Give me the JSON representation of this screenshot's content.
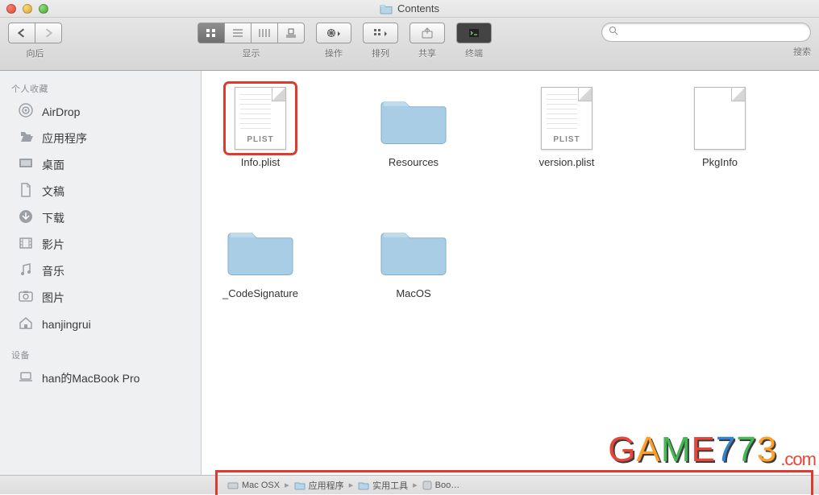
{
  "window": {
    "title": "Contents"
  },
  "toolbar": {
    "back_forward_label": "向后",
    "view_label": "显示",
    "action_label": "操作",
    "arrange_label": "排列",
    "share_label": "共享",
    "terminal_label": "终端",
    "search_label": "搜索",
    "search_placeholder": ""
  },
  "sidebar": {
    "favorites_header": "个人收藏",
    "devices_header": "设备",
    "favorites": [
      {
        "label": "AirDrop",
        "icon": "airdrop-icon"
      },
      {
        "label": "应用程序",
        "icon": "apps-icon"
      },
      {
        "label": "桌面",
        "icon": "desktop-icon"
      },
      {
        "label": "文稿",
        "icon": "documents-icon"
      },
      {
        "label": "下载",
        "icon": "downloads-icon"
      },
      {
        "label": "影片",
        "icon": "movies-icon"
      },
      {
        "label": "音乐",
        "icon": "music-icon"
      },
      {
        "label": "图片",
        "icon": "pictures-icon"
      },
      {
        "label": "hanjingrui",
        "icon": "home-icon"
      }
    ],
    "devices": [
      {
        "label": "han的MacBook Pro",
        "icon": "laptop-icon"
      }
    ]
  },
  "files": [
    {
      "name": "Info.plist",
      "kind": "plist",
      "selected": true
    },
    {
      "name": "Resources",
      "kind": "folder",
      "selected": false
    },
    {
      "name": "version.plist",
      "kind": "plist",
      "selected": false
    },
    {
      "name": "PkgInfo",
      "kind": "file",
      "selected": false
    },
    {
      "name": "_CodeSignature",
      "kind": "folder",
      "selected": false
    },
    {
      "name": "MacOS",
      "kind": "folder",
      "selected": false
    }
  ],
  "pathbar": {
    "segments": [
      {
        "label": "Mac OSX",
        "icon": "disk-icon"
      },
      {
        "label": "应用程序",
        "icon": "folder-icon"
      },
      {
        "label": "实用工具",
        "icon": "folder-icon"
      },
      {
        "label": "Boo…",
        "icon": "app-icon"
      }
    ]
  },
  "watermark": "GAME773.com"
}
